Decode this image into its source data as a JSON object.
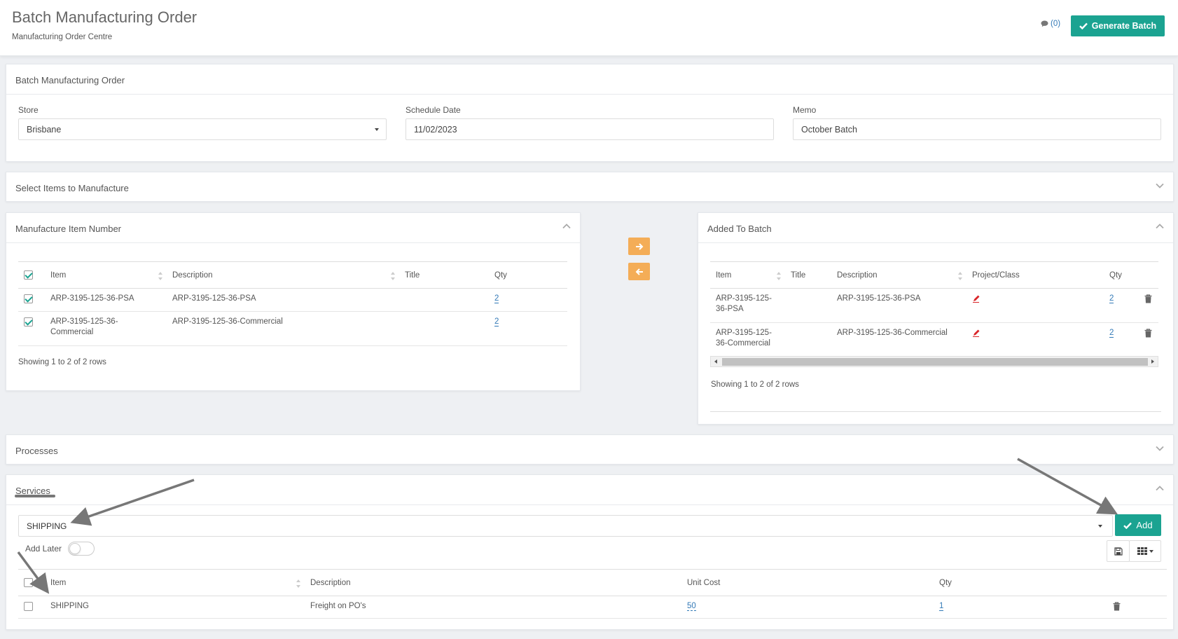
{
  "header": {
    "title": "Batch Manufacturing Order",
    "subtitle": "Manufacturing Order Centre",
    "comments_label": "(0)",
    "generate_label": "Generate Batch"
  },
  "order_panel": {
    "title": "Batch Manufacturing Order",
    "store_label": "Store",
    "store_value": "Brisbane",
    "schedule_label": "Schedule Date",
    "schedule_value": "11/02/2023",
    "memo_label": "Memo",
    "memo_value": "October Batch"
  },
  "select_items_panel": {
    "title": "Select Items to Manufacture"
  },
  "manufacture_panel": {
    "title": "Manufacture Item Number",
    "columns": [
      "Item",
      "Description",
      "Title",
      "Qty"
    ],
    "rows": [
      {
        "item": "ARP-3195-125-36-PSA",
        "description": "ARP-3195-125-36-PSA",
        "title": "",
        "qty": "2",
        "checked": true
      },
      {
        "item_line1": "ARP-3195-125-36-",
        "item_line2": "Commercial",
        "description": "ARP-3195-125-36-Commercial",
        "title": "",
        "qty": "2",
        "checked": true
      }
    ],
    "footer": "Showing 1 to 2 of 2 rows"
  },
  "batch_panel": {
    "title": "Added To Batch",
    "columns": [
      "Item",
      "Title",
      "Description",
      "Project/Class",
      "Qty"
    ],
    "rows": [
      {
        "item_line1": "ARP-3195-125-",
        "item_line2": "36-PSA",
        "title": "",
        "description": "ARP-3195-125-36-PSA",
        "qty": "2"
      },
      {
        "item_line1": "ARP-3195-125-",
        "item_line2": "36-Commercial",
        "title": "",
        "description": "ARP-3195-125-36-Commercial",
        "qty": "2"
      }
    ],
    "footer": "Showing 1 to 2 of 2 rows"
  },
  "processes_panel": {
    "title": "Processes"
  },
  "services_panel": {
    "title": "Services",
    "select_value": "SHIPPING",
    "add_label": "Add",
    "add_later_label": "Add Later",
    "columns": [
      "Item",
      "Description",
      "Unit Cost",
      "Qty"
    ],
    "rows": [
      {
        "item": "SHIPPING",
        "description": "Freight on PO's",
        "unit_cost": "50",
        "qty": "1"
      }
    ]
  },
  "colors": {
    "primary": "#1ba391",
    "warning": "#f4ad57",
    "link": "#337ab7",
    "pencil": "#d9262a"
  }
}
